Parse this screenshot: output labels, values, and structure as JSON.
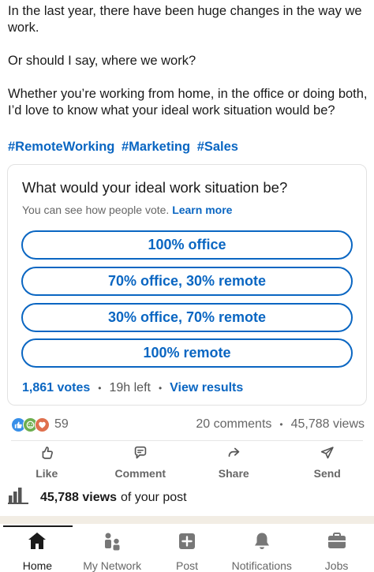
{
  "post": {
    "paragraphs": [
      "In the last year, there have been huge changes in the way we work.",
      "Or should I say, where we work?",
      "Whether you’re working from home, in the office or doing both, I’d love to know what your ideal work situation would be?"
    ],
    "hashtags": [
      "#RemoteWorking",
      "#Marketing",
      "#Sales"
    ]
  },
  "poll": {
    "question": "What would your ideal work situation be?",
    "note": "You can see how people vote.",
    "learn_more": "Learn more",
    "options": [
      "100% office",
      "70% office, 30% remote",
      "30% office, 70% remote",
      "100% remote"
    ],
    "votes": "1,861 votes",
    "time_left": "19h left",
    "view_results": "View results",
    "accent_color": "#0a66c2"
  },
  "social": {
    "reaction_icons": [
      "like-icon",
      "celebrate-icon",
      "love-icon"
    ],
    "reaction_count": "59",
    "comments": "20 comments",
    "views": "45,788 views"
  },
  "actions": [
    {
      "icon": "thumbs-up-icon",
      "label": "Like"
    },
    {
      "icon": "comment-icon",
      "label": "Comment"
    },
    {
      "icon": "share-icon",
      "label": "Share"
    },
    {
      "icon": "send-icon",
      "label": "Send"
    }
  ],
  "stats": {
    "icon": "bar-chart-icon",
    "views_number": "45,788 views",
    "suffix": "of your post"
  },
  "nav": [
    {
      "icon": "home-icon",
      "label": "Home",
      "active": true
    },
    {
      "icon": "my-network-icon",
      "label": "My Network"
    },
    {
      "icon": "post-icon",
      "label": "Post"
    },
    {
      "icon": "notifications-icon",
      "label": "Notifications"
    },
    {
      "icon": "jobs-icon",
      "label": "Jobs"
    }
  ]
}
